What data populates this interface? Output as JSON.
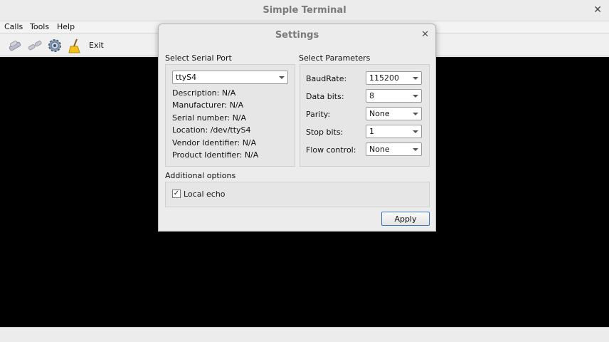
{
  "window": {
    "title": "Simple Terminal",
    "close_glyph": "✕"
  },
  "menu": {
    "items": [
      "Calls",
      "Tools",
      "Help"
    ]
  },
  "toolbar": {
    "icons": [
      "connect-icon",
      "disconnect-icon",
      "settings-gear-icon",
      "clear-broom-icon"
    ],
    "exit_label": "Exit"
  },
  "dialog": {
    "title": "Settings",
    "close_glyph": "✕",
    "serial_port": {
      "group_title": "Select Serial Port",
      "selected_port": "ttyS4",
      "info": [
        "Description: N/A",
        "Manufacturer: N/A",
        "Serial number: N/A",
        "Location: /dev/ttyS4",
        "Vendor Identifier: N/A",
        "Product Identifier: N/A"
      ]
    },
    "parameters": {
      "group_title": "Select Parameters",
      "baud_label": "BaudRate:",
      "baud_value": "115200",
      "databits_label": "Data bits:",
      "databits_value": "8",
      "parity_label": "Parity:",
      "parity_value": "None",
      "stopbits_label": "Stop bits:",
      "stopbits_value": "1",
      "flow_label": "Flow control:",
      "flow_value": "None"
    },
    "additional": {
      "group_title": "Additional options",
      "local_echo_label": "Local echo",
      "local_echo_checked": "✓"
    },
    "apply_label": "Apply"
  }
}
